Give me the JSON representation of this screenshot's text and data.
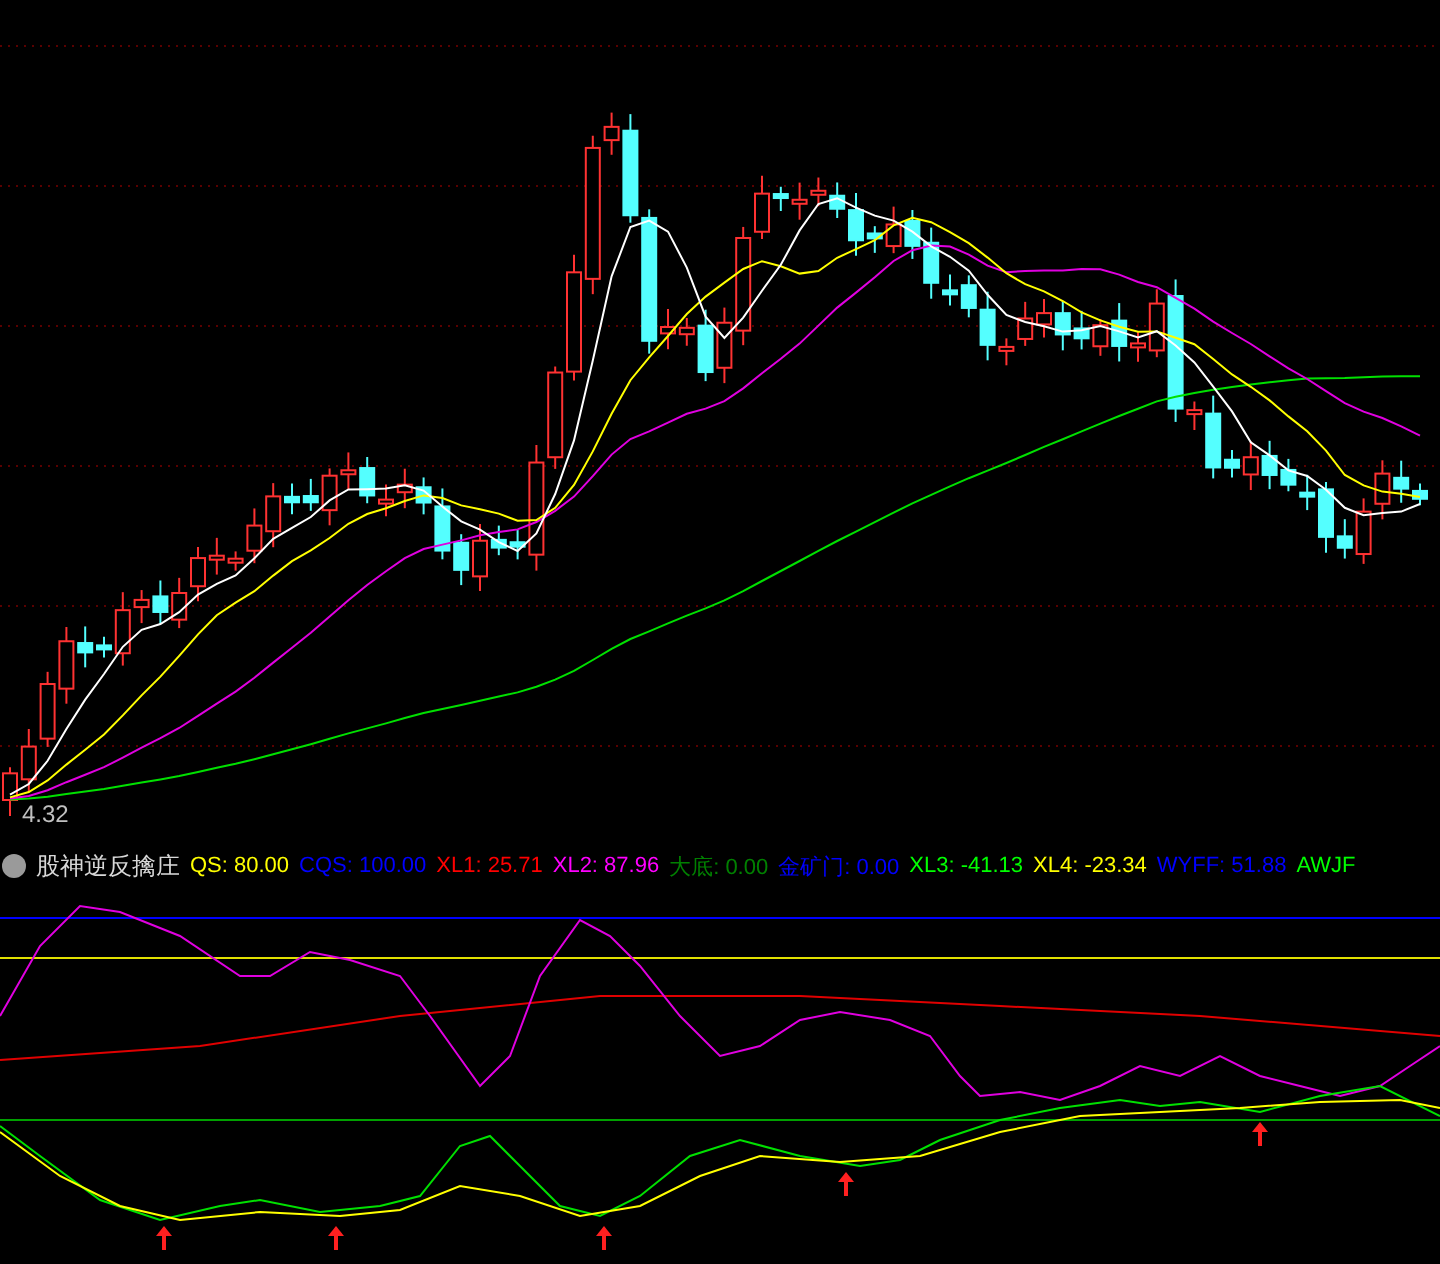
{
  "main_chart": {
    "price_label": "4.32"
  },
  "indicator": {
    "name": "股神逆反擒庄",
    "items": [
      {
        "text": "QS: 80.00",
        "color": "#ffff00"
      },
      {
        "text": "CQS: 100.00",
        "color": "#0000ff"
      },
      {
        "text": "XL1: 25.71",
        "color": "#ff0000"
      },
      {
        "text": "XL2: 87.96",
        "color": "#ff00ff"
      },
      {
        "text": "大底: 0.00",
        "color": "#008000"
      },
      {
        "text": "金矿门: 0.00",
        "color": "#0000ff"
      },
      {
        "text": "XL3: -41.13",
        "color": "#00ff00"
      },
      {
        "text": "XL4: -23.34",
        "color": "#ffff00"
      },
      {
        "text": "WYFF: 51.88",
        "color": "#0000ff"
      },
      {
        "text": "AWJF",
        "color": "#00ff00"
      }
    ]
  }
}
